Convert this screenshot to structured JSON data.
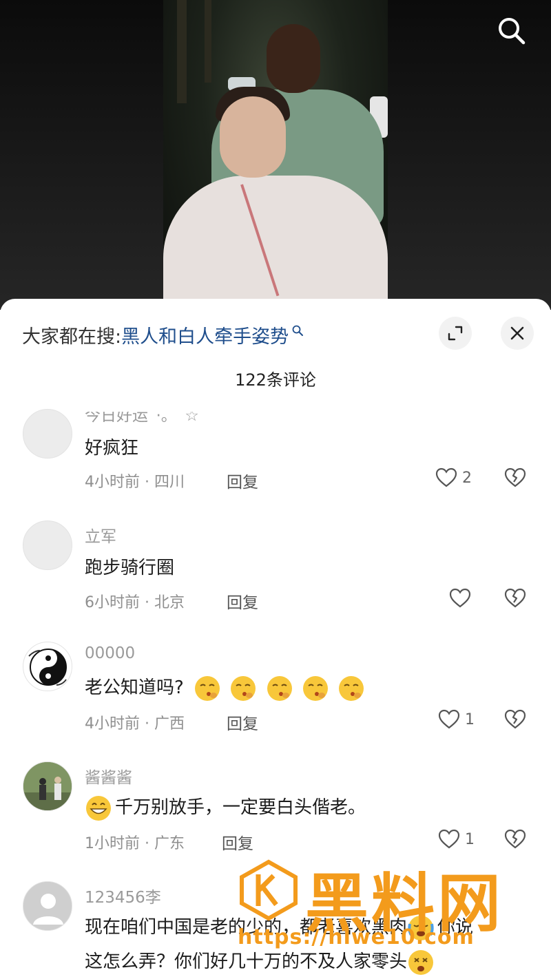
{
  "video": {
    "search_icon": "search-icon"
  },
  "sheet": {
    "suggest_prefix": "大家都在搜:",
    "suggest_query": "黑人和白人牵手姿势",
    "suggest_icon": "search-icon",
    "expand_icon": "expand-icon",
    "close_icon": "close-icon",
    "comment_count": "122条评论"
  },
  "comments": [
    {
      "name": "今日好运ˊ·。˚☆",
      "text": "好疯狂",
      "meta": "4小时前 · 四川",
      "reply": "回复",
      "likes": "2"
    },
    {
      "name": "立军",
      "text": "跑步骑行圈",
      "meta": "6小时前 · 北京",
      "reply": "回复",
      "likes": ""
    },
    {
      "name": "00000",
      "text": "老公知道吗?",
      "meta": "4小时前 · 广西",
      "reply": "回复",
      "likes": "1"
    },
    {
      "name": "酱酱酱",
      "text": "千万别放手，一定要白头偕老。",
      "meta": "1小时前 · 广东",
      "reply": "回复",
      "likes": "1"
    },
    {
      "name": "123456李",
      "text_line1": "现在咱们中国是老的少的，都老喜欢黑肉",
      "text_line1_end": "你说",
      "text_line2": "这怎么弄？你们好几十万的不及人家零头"
    }
  ],
  "watermark": {
    "title": "黑料网",
    "url": "https://hlwe10.com"
  },
  "colors": {
    "link": "#1f4e8c",
    "watermark": "#f39b1c",
    "meta": "#8f8f8f"
  }
}
